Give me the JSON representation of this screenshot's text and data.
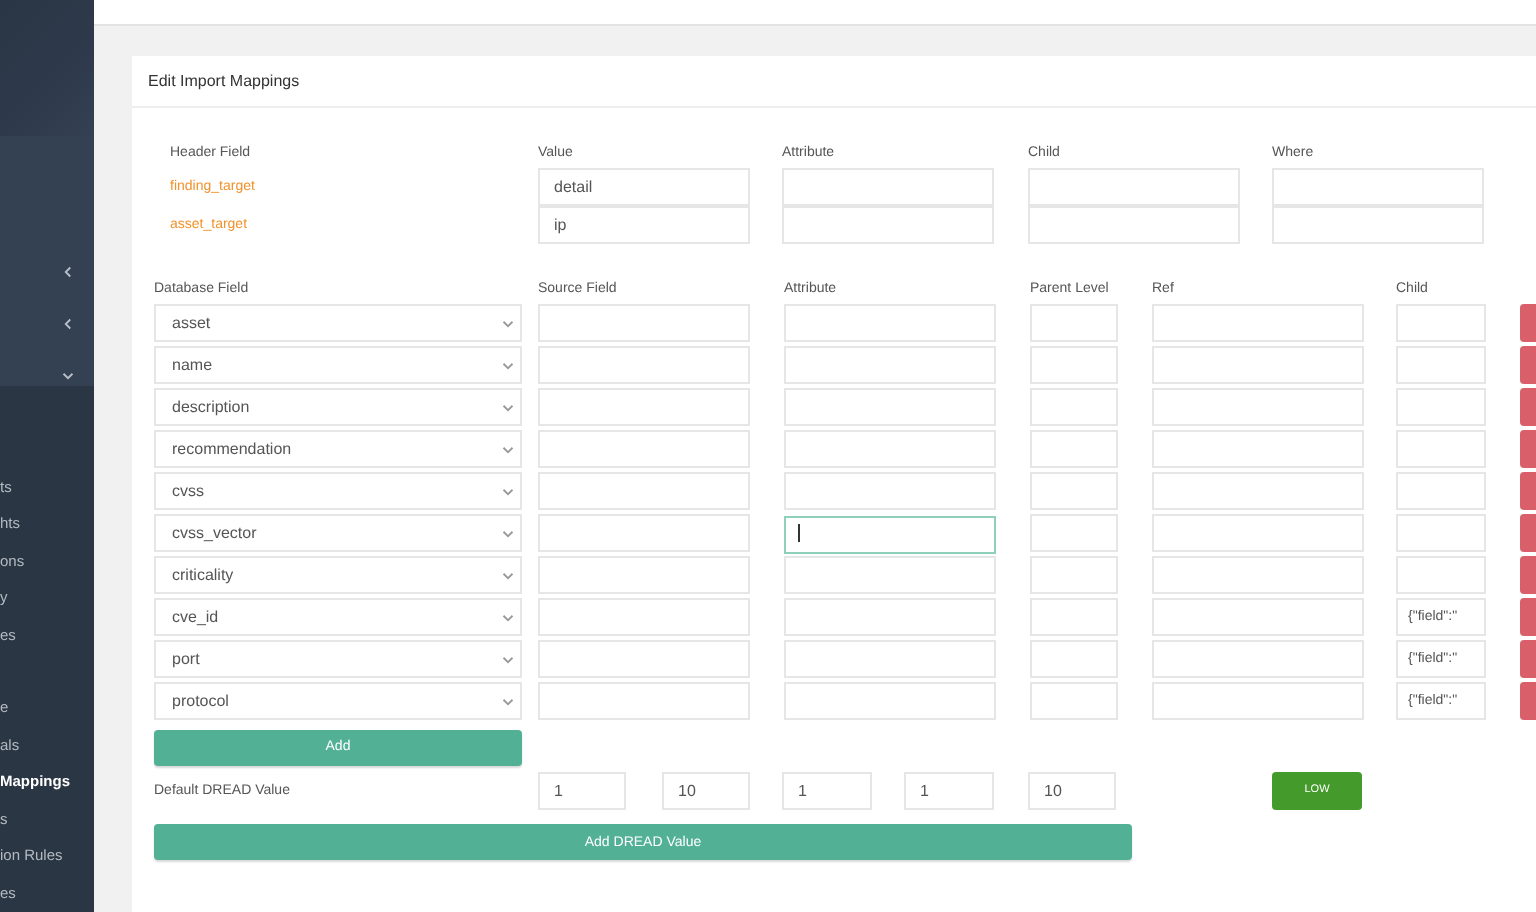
{
  "sidebar": {
    "groups": [
      {
        "expanded": false
      },
      {
        "expanded": false
      },
      {
        "expanded": true
      }
    ],
    "items": [
      {
        "label": "ts",
        "selected": false
      },
      {
        "label": "hts",
        "selected": false
      },
      {
        "label": "ons",
        "selected": false
      },
      {
        "label": "y",
        "selected": false
      },
      {
        "label": "es",
        "selected": false
      },
      {
        "label": "e",
        "selected": false
      },
      {
        "label": "als",
        "selected": false
      },
      {
        "label": "Mappings",
        "selected": true
      },
      {
        "label": "s",
        "selected": false
      },
      {
        "label": "ion Rules",
        "selected": false
      },
      {
        "label": "es",
        "selected": false
      }
    ]
  },
  "card": {
    "title": "Edit Import Mappings",
    "header_table": {
      "columns": [
        "Header Field",
        "Value",
        "Attribute",
        "Child",
        "Where"
      ],
      "rows": [
        {
          "field": "finding_target",
          "value": "detail",
          "attribute": "",
          "child": "",
          "where": ""
        },
        {
          "field": "asset_target",
          "value": "ip",
          "attribute": "",
          "child": "",
          "where": ""
        }
      ]
    },
    "mapping_table": {
      "columns": [
        "Database Field",
        "Source Field",
        "Attribute",
        "Parent Level",
        "Ref",
        "Child"
      ],
      "rows": [
        {
          "database_field": "asset",
          "source_field": "",
          "attribute": "",
          "attribute_focused": false,
          "parent_level": "",
          "ref": "",
          "child": ""
        },
        {
          "database_field": "name",
          "source_field": "",
          "attribute": "",
          "attribute_focused": false,
          "parent_level": "",
          "ref": "",
          "child": ""
        },
        {
          "database_field": "description",
          "source_field": "",
          "attribute": "",
          "attribute_focused": false,
          "parent_level": "",
          "ref": "",
          "child": ""
        },
        {
          "database_field": "recommendation",
          "source_field": "",
          "attribute": "",
          "attribute_focused": false,
          "parent_level": "",
          "ref": "",
          "child": ""
        },
        {
          "database_field": "cvss",
          "source_field": "",
          "attribute": "",
          "attribute_focused": false,
          "parent_level": "",
          "ref": "",
          "child": ""
        },
        {
          "database_field": "cvss_vector",
          "source_field": "",
          "attribute": "",
          "attribute_focused": true,
          "parent_level": "",
          "ref": "",
          "child": ""
        },
        {
          "database_field": "criticality",
          "source_field": "",
          "attribute": "",
          "attribute_focused": false,
          "parent_level": "",
          "ref": "",
          "child": ""
        },
        {
          "database_field": "cve_id",
          "source_field": "",
          "attribute": "",
          "attribute_focused": false,
          "parent_level": "",
          "ref": "",
          "child": "{\"field\":\""
        },
        {
          "database_field": "port",
          "source_field": "",
          "attribute": "",
          "attribute_focused": false,
          "parent_level": "",
          "ref": "",
          "child": "{\"field\":\""
        },
        {
          "database_field": "protocol",
          "source_field": "",
          "attribute": "",
          "attribute_focused": false,
          "parent_level": "",
          "ref": "",
          "child": "{\"field\":\""
        }
      ]
    },
    "add_button": "Add",
    "dread": {
      "label": "Default DREAD Value",
      "values": [
        "1",
        "10",
        "1",
        "1",
        "10"
      ],
      "rating": "LOW"
    },
    "add_dread_button": "Add DREAD Value"
  }
}
